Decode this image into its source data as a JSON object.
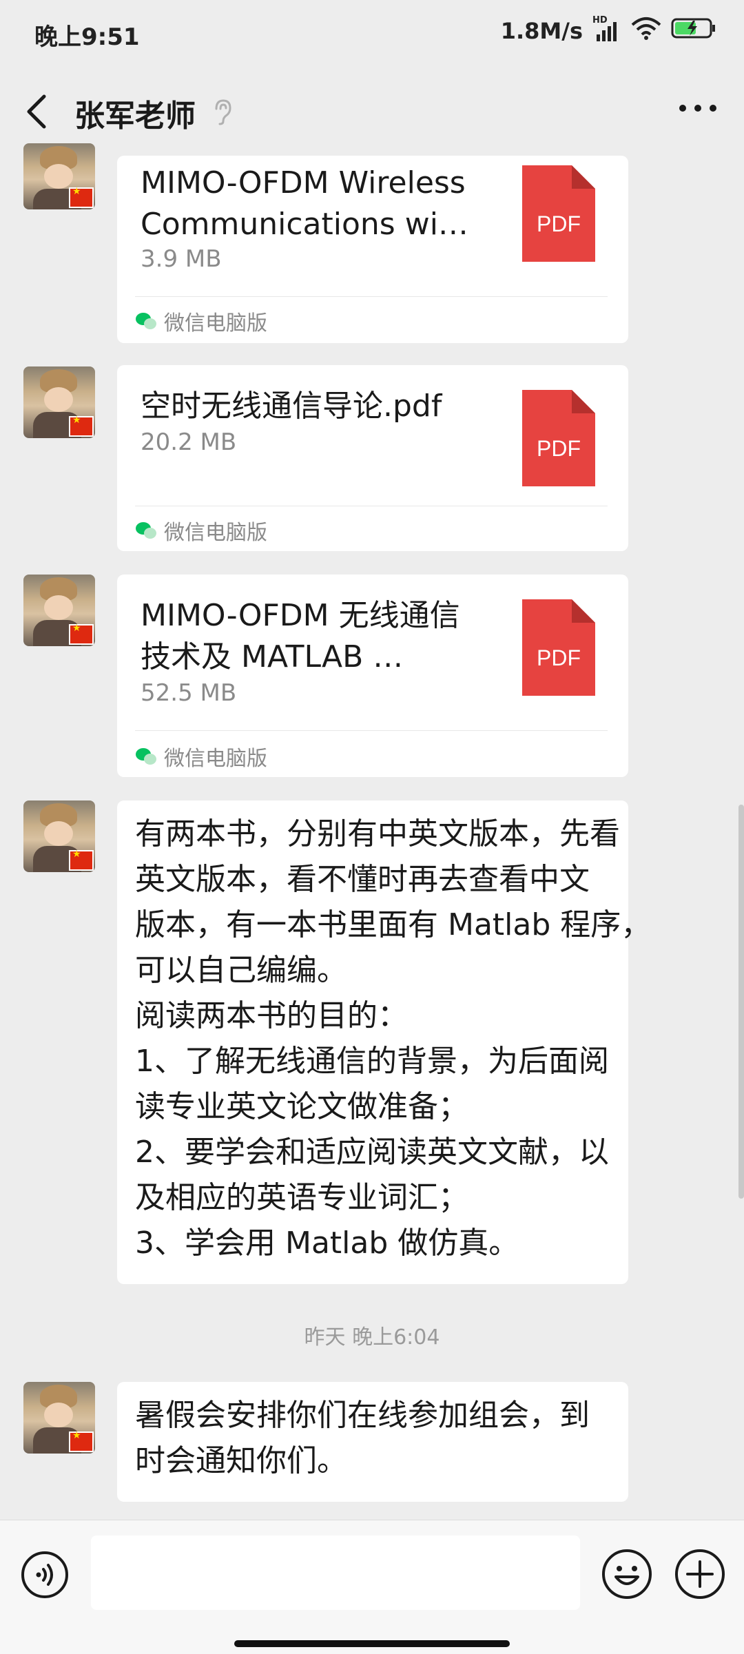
{
  "status_bar": {
    "time": "晚上9:51",
    "network_speed": "1.8M/s",
    "signal_label": "HD"
  },
  "header": {
    "contact_name": "张军老师"
  },
  "messages": [
    {
      "type": "file",
      "file_name_lines": [
        "MIMO-OFDM Wireless",
        "Communications wi…"
      ],
      "file_size": "3.9 MB",
      "file_icon_label": "PDF",
      "source": "微信电脑版"
    },
    {
      "type": "file",
      "file_name_lines": [
        "空时无线通信导论.pdf"
      ],
      "file_size": "20.2 MB",
      "file_icon_label": "PDF",
      "source": "微信电脑版"
    },
    {
      "type": "file",
      "file_name_lines": [
        "MIMO-OFDM 无线通信",
        "技术及 MATLAB …"
      ],
      "file_size": "52.5 MB",
      "file_icon_label": "PDF",
      "source": "微信电脑版"
    },
    {
      "type": "text",
      "lines": [
        "有两本书，分别有中英文版本，先看",
        "英文版本，看不懂时再去查看中文",
        "版本，有一本书里面有 Matlab 程序，",
        "可以自己编编。",
        "阅读两本书的目的：",
        "1、了解无线通信的背景，为后面阅",
        "读专业英文论文做准备；",
        "2、要学会和适应阅读英文文献，以",
        "及相应的英语专业词汇；",
        "3、学会用 Matlab 做仿真。"
      ]
    },
    {
      "type": "timestamp",
      "text": "昨天 晚上6:04"
    },
    {
      "type": "text",
      "lines": [
        "暑假会安排你们在线参加组会，到",
        "时会通知你们。"
      ]
    }
  ],
  "colors": {
    "background": "#ededed",
    "pdf_red": "#e64340",
    "wechat_green": "#07c160"
  }
}
